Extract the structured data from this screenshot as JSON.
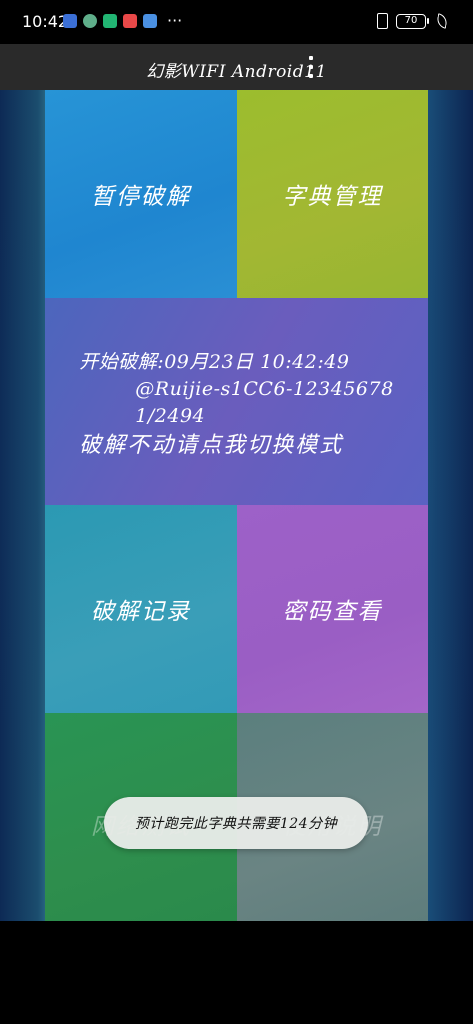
{
  "status_bar": {
    "time": "10:42",
    "battery": "70",
    "app_icon_colors": [
      "#3b6fd6",
      "#5fae8a",
      "#22b573",
      "#e84848",
      "#4a90e2"
    ],
    "more": "···"
  },
  "app_bar": {
    "title": "幻影WIFI Android11"
  },
  "tiles": {
    "pause": "暂停破解",
    "dict": "字典管理",
    "main": {
      "line1": "开始破解:09月23日  10:42:49",
      "line2": "@Ruijie-s1CC6-12345678",
      "line3": "1/2494",
      "line4": "破解不动请点我切换模式"
    },
    "records": "破解记录",
    "passwords": "密码查看",
    "network": "网络测试",
    "help": "使用说明"
  },
  "toast": {
    "text": "预计跑完此字典共需要124分钟"
  }
}
